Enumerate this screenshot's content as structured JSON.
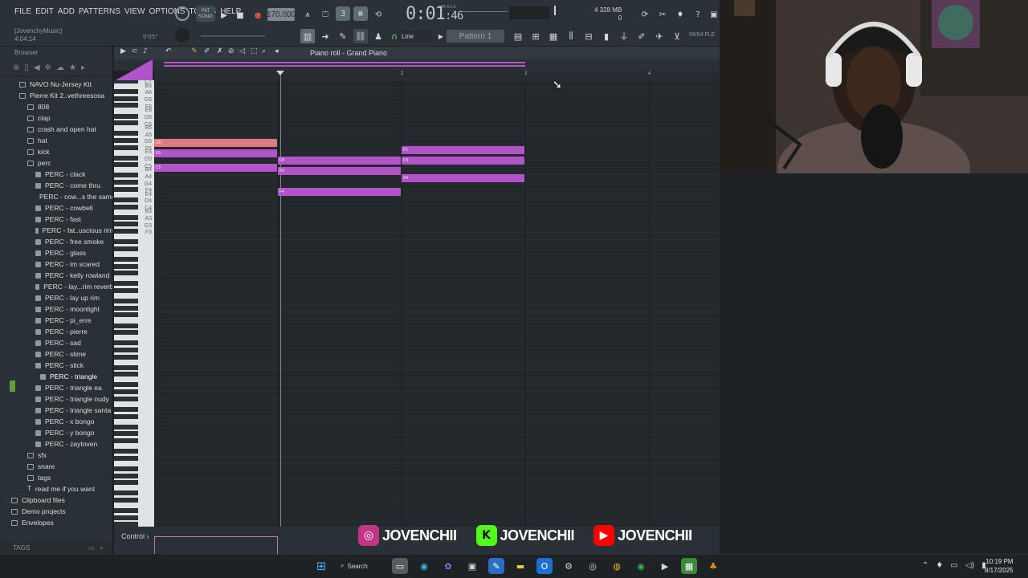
{
  "menu": [
    "FILE",
    "EDIT",
    "ADD",
    "PATTERNS",
    "VIEW",
    "OPTIONS",
    "TOOLS",
    "HELP"
  ],
  "session": {
    "name": "[JovenchyMusic]",
    "time": "4:04:14",
    "position": "0'05\""
  },
  "transport": {
    "mode_top": "PAT",
    "mode_bottom": "SONG",
    "tempo": "170.000",
    "time_main": "0:01",
    "time_small": ":46",
    "time_unit": "M:S:CS"
  },
  "cpu": {
    "line1": "4   328 MB",
    "line2": "0"
  },
  "toolbar2": {
    "snap": "Line",
    "pattern": "Pattern 1",
    "news": "06/04 FLE"
  },
  "browser": {
    "header": "Browser",
    "footer": "TAGS",
    "items": [
      {
        "label": "NAVO Nu-Jersey Kit",
        "kind": "folder",
        "indent": 1
      },
      {
        "label": "Pierre Kit 2..vethreesosa",
        "kind": "folder",
        "indent": 1
      },
      {
        "label": "808",
        "kind": "folder",
        "indent": 2
      },
      {
        "label": "clap",
        "kind": "folder",
        "indent": 2
      },
      {
        "label": "crash and open hat",
        "kind": "folder",
        "indent": 2
      },
      {
        "label": "hat",
        "kind": "folder",
        "indent": 2
      },
      {
        "label": "kick",
        "kind": "folder",
        "indent": 2
      },
      {
        "label": "perc",
        "kind": "folder",
        "indent": 2
      },
      {
        "label": "PERC - clack",
        "kind": "file",
        "indent": 3
      },
      {
        "label": "PERC - come thru",
        "kind": "file",
        "indent": 3
      },
      {
        "label": "PERC - cow...s the same",
        "kind": "file",
        "indent": 3
      },
      {
        "label": "PERC - cowbell",
        "kind": "file",
        "indent": 3
      },
      {
        "label": "PERC - fast",
        "kind": "file",
        "indent": 3
      },
      {
        "label": "PERC - fat..uscious rim",
        "kind": "file",
        "indent": 3
      },
      {
        "label": "PERC - free smoke",
        "kind": "file",
        "indent": 3
      },
      {
        "label": "PERC - glass",
        "kind": "file",
        "indent": 3
      },
      {
        "label": "PERC - im scared",
        "kind": "file",
        "indent": 3
      },
      {
        "label": "PERC - kelly rowland",
        "kind": "file",
        "indent": 3
      },
      {
        "label": "PERC - lay...rim reverb",
        "kind": "file",
        "indent": 3
      },
      {
        "label": "PERC - lay up rim",
        "kind": "file",
        "indent": 3
      },
      {
        "label": "PERC - moonlight",
        "kind": "file",
        "indent": 3
      },
      {
        "label": "PERC - pi_erre",
        "kind": "file",
        "indent": 3
      },
      {
        "label": "PERC - pierre",
        "kind": "file",
        "indent": 3
      },
      {
        "label": "PERC - sad",
        "kind": "file",
        "indent": 3
      },
      {
        "label": "PERC - slime",
        "kind": "file",
        "indent": 3
      },
      {
        "label": "PERC - stick",
        "kind": "file",
        "indent": 3
      },
      {
        "label": "PERC - triangle",
        "kind": "file",
        "indent": 3,
        "selected": true
      },
      {
        "label": "PERC - triangle ea",
        "kind": "file",
        "indent": 3
      },
      {
        "label": "PERC - triangle nudy",
        "kind": "file",
        "indent": 3
      },
      {
        "label": "PERC - triangle santa",
        "kind": "file",
        "indent": 3
      },
      {
        "label": "PERC - x bongo",
        "kind": "file",
        "indent": 3
      },
      {
        "label": "PERC - y bongo",
        "kind": "file",
        "indent": 3
      },
      {
        "label": "PERC - zaytoven",
        "kind": "file",
        "indent": 3
      },
      {
        "label": "sfx",
        "kind": "folder",
        "indent": 2
      },
      {
        "label": "snare",
        "kind": "folder",
        "indent": 2
      },
      {
        "label": "tags",
        "kind": "folder",
        "indent": 2
      },
      {
        "label": "read me if you want",
        "kind": "text",
        "indent": 2
      },
      {
        "label": "Clipboard files",
        "kind": "folder",
        "indent": 0
      },
      {
        "label": "Demo projects",
        "kind": "folder",
        "indent": 0
      },
      {
        "label": "Envelopes",
        "kind": "folder",
        "indent": 0
      }
    ]
  },
  "piano_roll": {
    "title": "Piano roll - Grand Piano",
    "bars": [
      "2",
      "3",
      "4",
      "5"
    ],
    "key_labels": [
      "C7",
      "B6",
      "A6",
      "G6",
      "F6",
      "E6",
      "D6",
      "C6",
      "B5",
      "A5",
      "G5",
      "F5",
      "E5",
      "D5",
      "C5",
      "B4",
      "A4",
      "G4",
      "F4",
      "E4",
      "D4",
      "C4",
      "B3",
      "A3",
      "G3",
      "F3"
    ],
    "notes": [
      {
        "label": "G5",
        "pitch": "G5",
        "start_bar": 1.0,
        "length_bars": 1.0,
        "color": "#e07a82"
      },
      {
        "label": "E5",
        "pitch": "E5",
        "start_bar": 1.0,
        "length_bars": 1.0,
        "color": "#b154c9"
      },
      {
        "label": "C5",
        "pitch": "C5",
        "start_bar": 1.0,
        "length_bars": 1.0,
        "color": "#b154c9"
      },
      {
        "label": "D5",
        "pitch": "D5",
        "start_bar": 2.0,
        "length_bars": 1.0,
        "color": "#b154c9"
      },
      {
        "label": "B4",
        "pitch": "B4",
        "start_bar": 2.0,
        "length_bars": 1.0,
        "color": "#b154c9"
      },
      {
        "label": "F4",
        "pitch": "F4",
        "start_bar": 2.0,
        "length_bars": 1.0,
        "color": "#b154c9"
      },
      {
        "label": "F5",
        "pitch": "F5",
        "start_bar": 3.0,
        "length_bars": 1.0,
        "color": "#b154c9"
      },
      {
        "label": "D5",
        "pitch": "D5",
        "start_bar": 3.0,
        "length_bars": 1.0,
        "color": "#b154c9"
      },
      {
        "label": "A4",
        "pitch": "A4",
        "start_bar": 3.0,
        "length_bars": 1.0,
        "color": "#b154c9"
      }
    ],
    "control_label": "Control"
  },
  "socials": [
    {
      "platform": "instagram",
      "handle": "JOVENCHII",
      "color": "#c13584",
      "glyph": "◎"
    },
    {
      "platform": "kick",
      "handle": "JOVENCHII",
      "color": "#53fc18",
      "glyph": "K"
    },
    {
      "platform": "youtube",
      "handle": "JOVENCHII",
      "color": "#ff0000",
      "glyph": "▶"
    }
  ],
  "taskbar": {
    "search_label": "Search",
    "time": "10:19 PM",
    "date": "8/17/2025"
  }
}
